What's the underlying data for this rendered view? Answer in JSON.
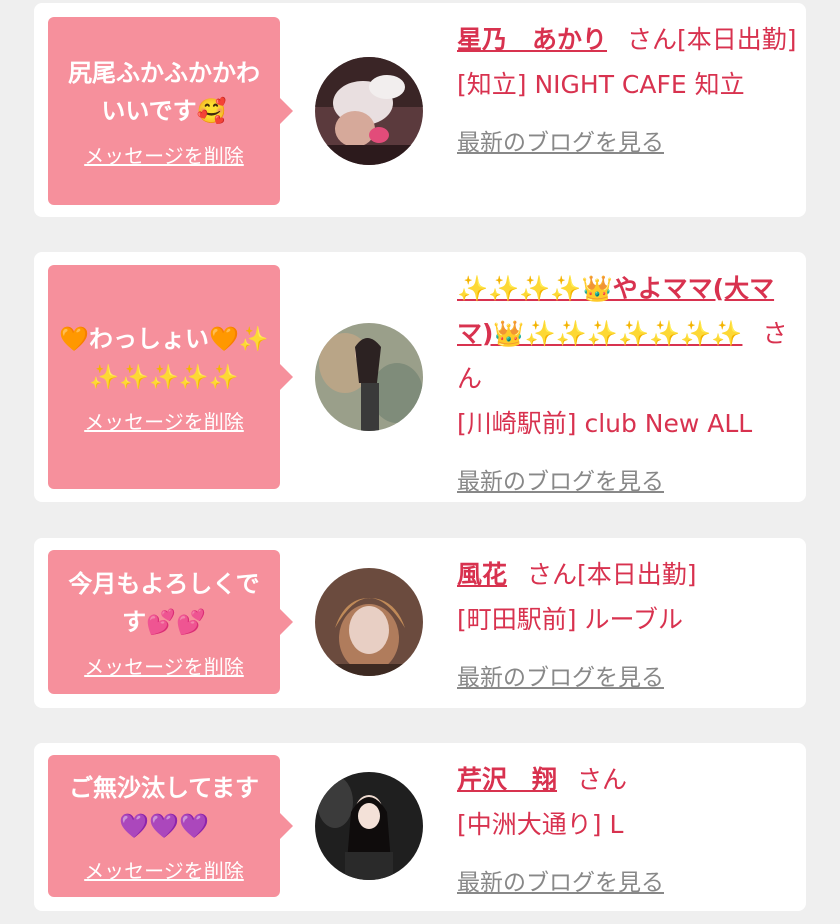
{
  "colors": {
    "background": "#efefef",
    "card": "#ffffff",
    "bubble": "#f6909c",
    "accent": "#d8324f",
    "link_gray": "#888888"
  },
  "entries": [
    {
      "message": "尻尾ふかふかかわいいです🥰",
      "delete_label": "メッセージを削除",
      "name": "星乃　あかり",
      "honorific": "さん",
      "status": "[本日出勤]",
      "shop": "[知立] NIGHT CAFE 知立",
      "blog_label": "最新のブログを見る"
    },
    {
      "message": "🧡わっしょい🧡✨✨✨✨✨✨",
      "delete_label": "メッセージを削除",
      "name": "✨✨✨✨👑やよママ(大ママ)👑✨✨✨✨✨✨✨",
      "honorific": "さん",
      "status": "",
      "shop": "[川崎駅前] club New ALL",
      "blog_label": "最新のブログを見る"
    },
    {
      "message": "今月もよろしくです💕💕",
      "delete_label": "メッセージを削除",
      "name": "風花",
      "honorific": "さん",
      "status": "[本日出勤]",
      "shop": "[町田駅前] ルーブル",
      "blog_label": "最新のブログを見る"
    },
    {
      "message": "ご無沙汰してます💜💜💜",
      "delete_label": "メッセージを削除",
      "name": "芹沢　翔",
      "honorific": "さん",
      "status": "",
      "shop": "[中洲大通り] L",
      "blog_label": "最新のブログを見る"
    }
  ]
}
